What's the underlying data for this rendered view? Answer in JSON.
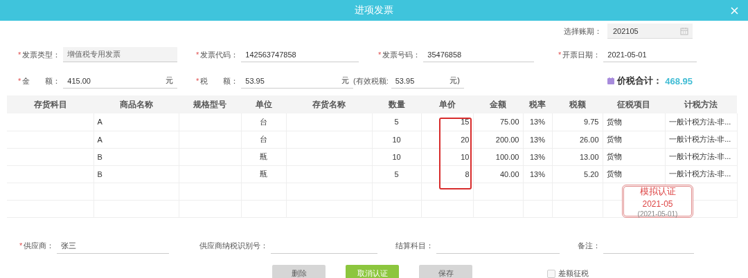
{
  "window": {
    "title": "进项发票"
  },
  "period": {
    "label": "选择账期：",
    "value": "202105"
  },
  "fields": [
    {
      "label": "发票类型：",
      "required_mark": "*",
      "value": "增值税专用发票",
      "disabled": true
    },
    {
      "label": "发票代码：",
      "required_mark": "*",
      "value": "142563747858",
      "disabled": false
    },
    {
      "label": "发票号码：",
      "required_mark": "*",
      "value": "35476858",
      "disabled": false
    },
    {
      "label": "开票日期：",
      "required_mark": "*",
      "value": "2021-05-01",
      "disabled": false
    }
  ],
  "amounts": [
    {
      "label": "金　　额：",
      "required_mark": "*",
      "value": "415.00",
      "unit": "元"
    },
    {
      "label": "税　　额：",
      "required_mark": "*",
      "value": "53.95",
      "unit": "元"
    },
    {
      "label": "(有效税额:",
      "value": "53.95",
      "unit": "元)"
    }
  ],
  "total": {
    "label": "价税合计：",
    "value": "468.95"
  },
  "table": {
    "columns": [
      {
        "label": "存货科目",
        "highlighted": false
      },
      {
        "label": "商品名称",
        "highlighted": false
      },
      {
        "label": "规格型号",
        "highlighted": false
      },
      {
        "label": "单位",
        "highlighted": false
      },
      {
        "label": "存货名称",
        "highlighted": false
      },
      {
        "label": "数量",
        "highlighted": false
      },
      {
        "label": "单价",
        "highlighted": true
      },
      {
        "label": "金额",
        "highlighted": false
      },
      {
        "label": "税率",
        "highlighted": false
      },
      {
        "label": "税额",
        "highlighted": false
      },
      {
        "label": "征税项目",
        "highlighted": false
      },
      {
        "label": "计税方法",
        "highlighted": false
      }
    ],
    "rows": [
      {
        "product": "A",
        "unit": "台",
        "qty": "5",
        "price": "15",
        "amount": "75.00",
        "rate": "13%",
        "tax": "9.75",
        "tax_item": "货物",
        "method": "一般计税方法-非..."
      },
      {
        "product": "A",
        "unit": "台",
        "qty": "10",
        "price": "20",
        "amount": "200.00",
        "rate": "13%",
        "tax": "26.00",
        "tax_item": "货物",
        "method": "一般计税方法-非..."
      },
      {
        "product": "B",
        "unit": "瓶",
        "qty": "10",
        "price": "10",
        "amount": "100.00",
        "rate": "13%",
        "tax": "13.00",
        "tax_item": "货物",
        "method": "一般计税方法-非..."
      },
      {
        "product": "B",
        "unit": "瓶",
        "qty": "5",
        "price": "8",
        "amount": "40.00",
        "rate": "13%",
        "tax": "5.20",
        "tax_item": "货物",
        "method": "一般计税方法-非..."
      }
    ]
  },
  "stamp": {
    "title": "模拟认证",
    "period": "2021-05",
    "date": "(2021-05-01)"
  },
  "footer_fields": [
    {
      "label": "供应商：",
      "required_mark": "*",
      "value": "张三"
    },
    {
      "label": "供应商纳税识别号："
    },
    {
      "label": "结算科目："
    },
    {
      "label": "备注："
    }
  ],
  "buttons": [
    {
      "label": "删除",
      "disabled": true
    },
    {
      "label": "取消认证",
      "disabled": false
    },
    {
      "label": "保存",
      "disabled": true
    }
  ],
  "checkbox": {
    "label": "差额征税",
    "checked": false
  }
}
